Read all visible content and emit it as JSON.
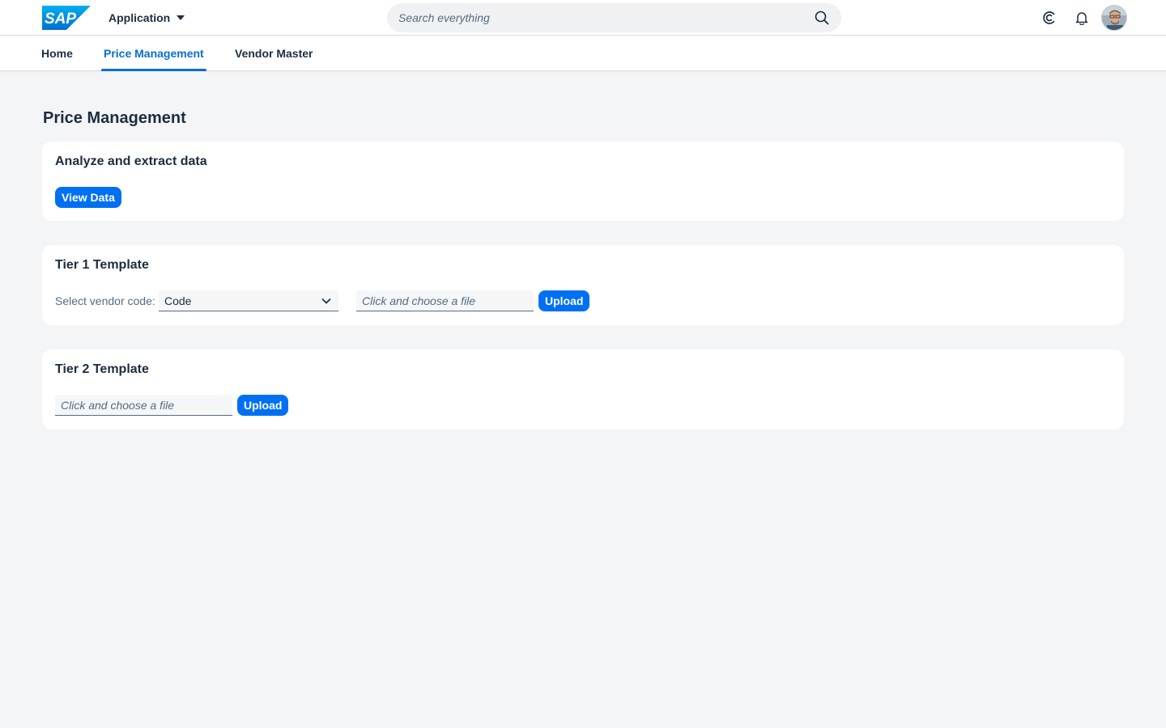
{
  "shell": {
    "brand_logo_text": "SAP",
    "app_title": "Application",
    "search_placeholder": "Search everything",
    "icons": [
      "chevron-down-icon",
      "search-icon",
      "joule-icon",
      "bell-icon",
      "avatar"
    ]
  },
  "tabs": [
    {
      "label": "Home",
      "active": false
    },
    {
      "label": "Price Management",
      "active": true
    },
    {
      "label": "Vendor Master",
      "active": false
    }
  ],
  "page": {
    "title": "Price Management"
  },
  "analyze_card": {
    "title": "Analyze and extract data",
    "button_label": "View Data"
  },
  "tier1_card": {
    "title": "Tier 1 Template",
    "vendor_label": "Select vendor code:",
    "vendor_selected": "Code",
    "file_placeholder": "Click and choose a file",
    "upload_label": "Upload"
  },
  "tier2_card": {
    "title": "Tier 2 Template",
    "file_placeholder": "Click and choose a file",
    "upload_label": "Upload"
  },
  "colors": {
    "brand_blue": "#0070f2",
    "active_tab": "#0a6ed1",
    "background": "#f4f5f7",
    "text": "#1d2d3e"
  }
}
